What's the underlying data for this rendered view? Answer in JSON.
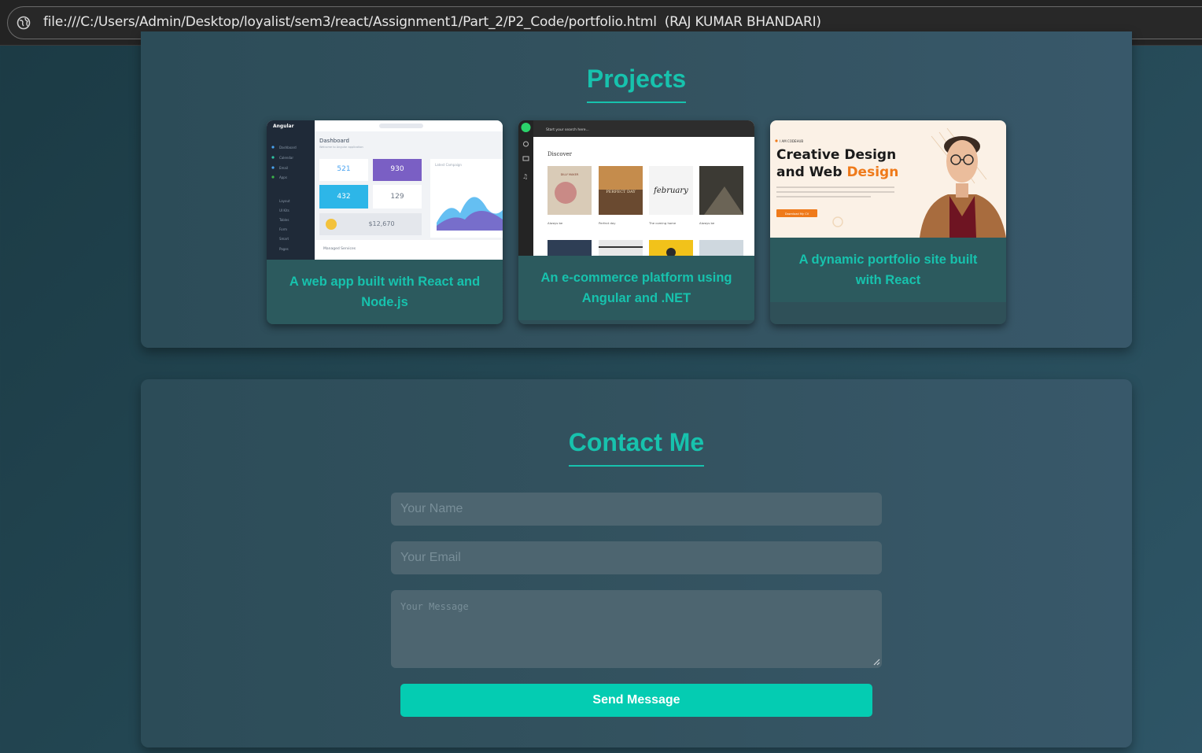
{
  "browser": {
    "url": "file:///C:/Users/Admin/Desktop/loyalist/sem3/react/Assignment1/Part_2/P2_Code/portfolio.html",
    "page_title": "(RAJ KUMAR BHANDARI)"
  },
  "projects": {
    "title": "Projects",
    "cards": [
      {
        "description": "A web app built with React and Node.js",
        "thumbnail": {
          "brand": "Angular",
          "heading": "Dashboard",
          "subheading": "Welcome to Angular application",
          "nav_items": [
            "Dashboard",
            "Calendar",
            "Email",
            "Apps",
            "Layout",
            "UI Kits",
            "Tables",
            "Form",
            "Smart",
            "Pages"
          ],
          "stats": [
            "521",
            "930",
            "432",
            "129",
            "$12,670"
          ],
          "chart_label": "Latest Campaign",
          "footer": "Managed Services"
        }
      },
      {
        "description": "An e-commerce platform using Angular and .NET",
        "thumbnail": {
          "search_placeholder": "Start your search here...",
          "heading": "Discover",
          "covers": [
            "DILLY MAKER",
            "PERFECT DAY",
            "february",
            ""
          ],
          "cover_titles": [
            "Always be",
            "Perfect day",
            "The coming home",
            "Always be"
          ]
        }
      },
      {
        "description": "A dynamic portfolio site built with React",
        "thumbnail": {
          "tagline": "I AM CODEHUB",
          "headline_line1": "Creative Design",
          "headline_line2_a": "and Web ",
          "headline_line2_b": "Design",
          "button": "Download My CV"
        }
      }
    ]
  },
  "contact": {
    "title": "Contact Me",
    "name_placeholder": "Your Name",
    "email_placeholder": "Your Email",
    "message_placeholder": "Your Message",
    "send_label": "Send Message"
  },
  "colors": {
    "accent": "#17c2ad",
    "button": "#04ccb2",
    "field_bg": "#4d6570"
  }
}
